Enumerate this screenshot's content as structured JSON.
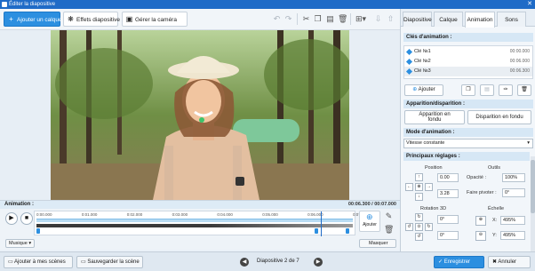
{
  "window": {
    "title": "Éditer la diapositive",
    "close": "✕"
  },
  "toolbar": {
    "add_layer": "Ajouter un calque",
    "effects": "Effets diapositive",
    "camera": "Gérer la caméra"
  },
  "animation": {
    "title": "Animation :",
    "time": "00:06.300 / 00:07.000",
    "ticks": [
      "0:00.000",
      "0:01.000",
      "0:02.000",
      "0:03.000",
      "0:04.000",
      "0:05.000",
      "0:06.000",
      "0:07.0"
    ],
    "playhead_fraction": 0.9,
    "markers": [
      0.0,
      0.89,
      0.99
    ],
    "add_label": "Ajouter",
    "music": "Musique",
    "hide": "Masquer"
  },
  "status": {
    "add_to_scenes": "Ajouter à mes scènes",
    "save_scene": "Sauvegarder la scène",
    "slide_info": "Diapositive 2 de 7",
    "save": "Enregistrer",
    "cancel": "Annuler"
  },
  "tabs": [
    "Diapositive",
    "Calque",
    "Animation",
    "Sons"
  ],
  "active_tab": "Animation",
  "keys": {
    "title": "Clés d'animation :",
    "items": [
      {
        "label": "Clé №1",
        "time": "00:00.000"
      },
      {
        "label": "Clé №2",
        "time": "00:06.000"
      },
      {
        "label": "Clé №3",
        "time": "00:06.300"
      }
    ],
    "add": "Ajouter"
  },
  "appear": {
    "title": "Apparition/disparition :",
    "appear_btn_1": "Apparition en",
    "appear_btn_2": "fondu",
    "disappear_btn": "Disparition en fondu"
  },
  "mode": {
    "title": "Mode d'animation :",
    "value": "Vitesse constante"
  },
  "settings": {
    "title": "Principaux réglages :",
    "position": "Position",
    "pos_x": "0.00",
    "pos_y": "3.28",
    "outils": "Outils",
    "opacity_label": "Opacité :",
    "opacity": "100%",
    "pivot_label": "Faire pivoter :",
    "pivot": "0°",
    "rotation_label": "Rotation 3D",
    "rot_a": "0°",
    "rot_b": "0°",
    "scale_label": "Échelle",
    "scale_x_label": "X:",
    "scale_x": "495%",
    "scale_y_label": "Y:",
    "scale_y": "495%"
  },
  "colors": {
    "accent": "#2c8fe0",
    "titlebar": "#1f6bc7"
  }
}
